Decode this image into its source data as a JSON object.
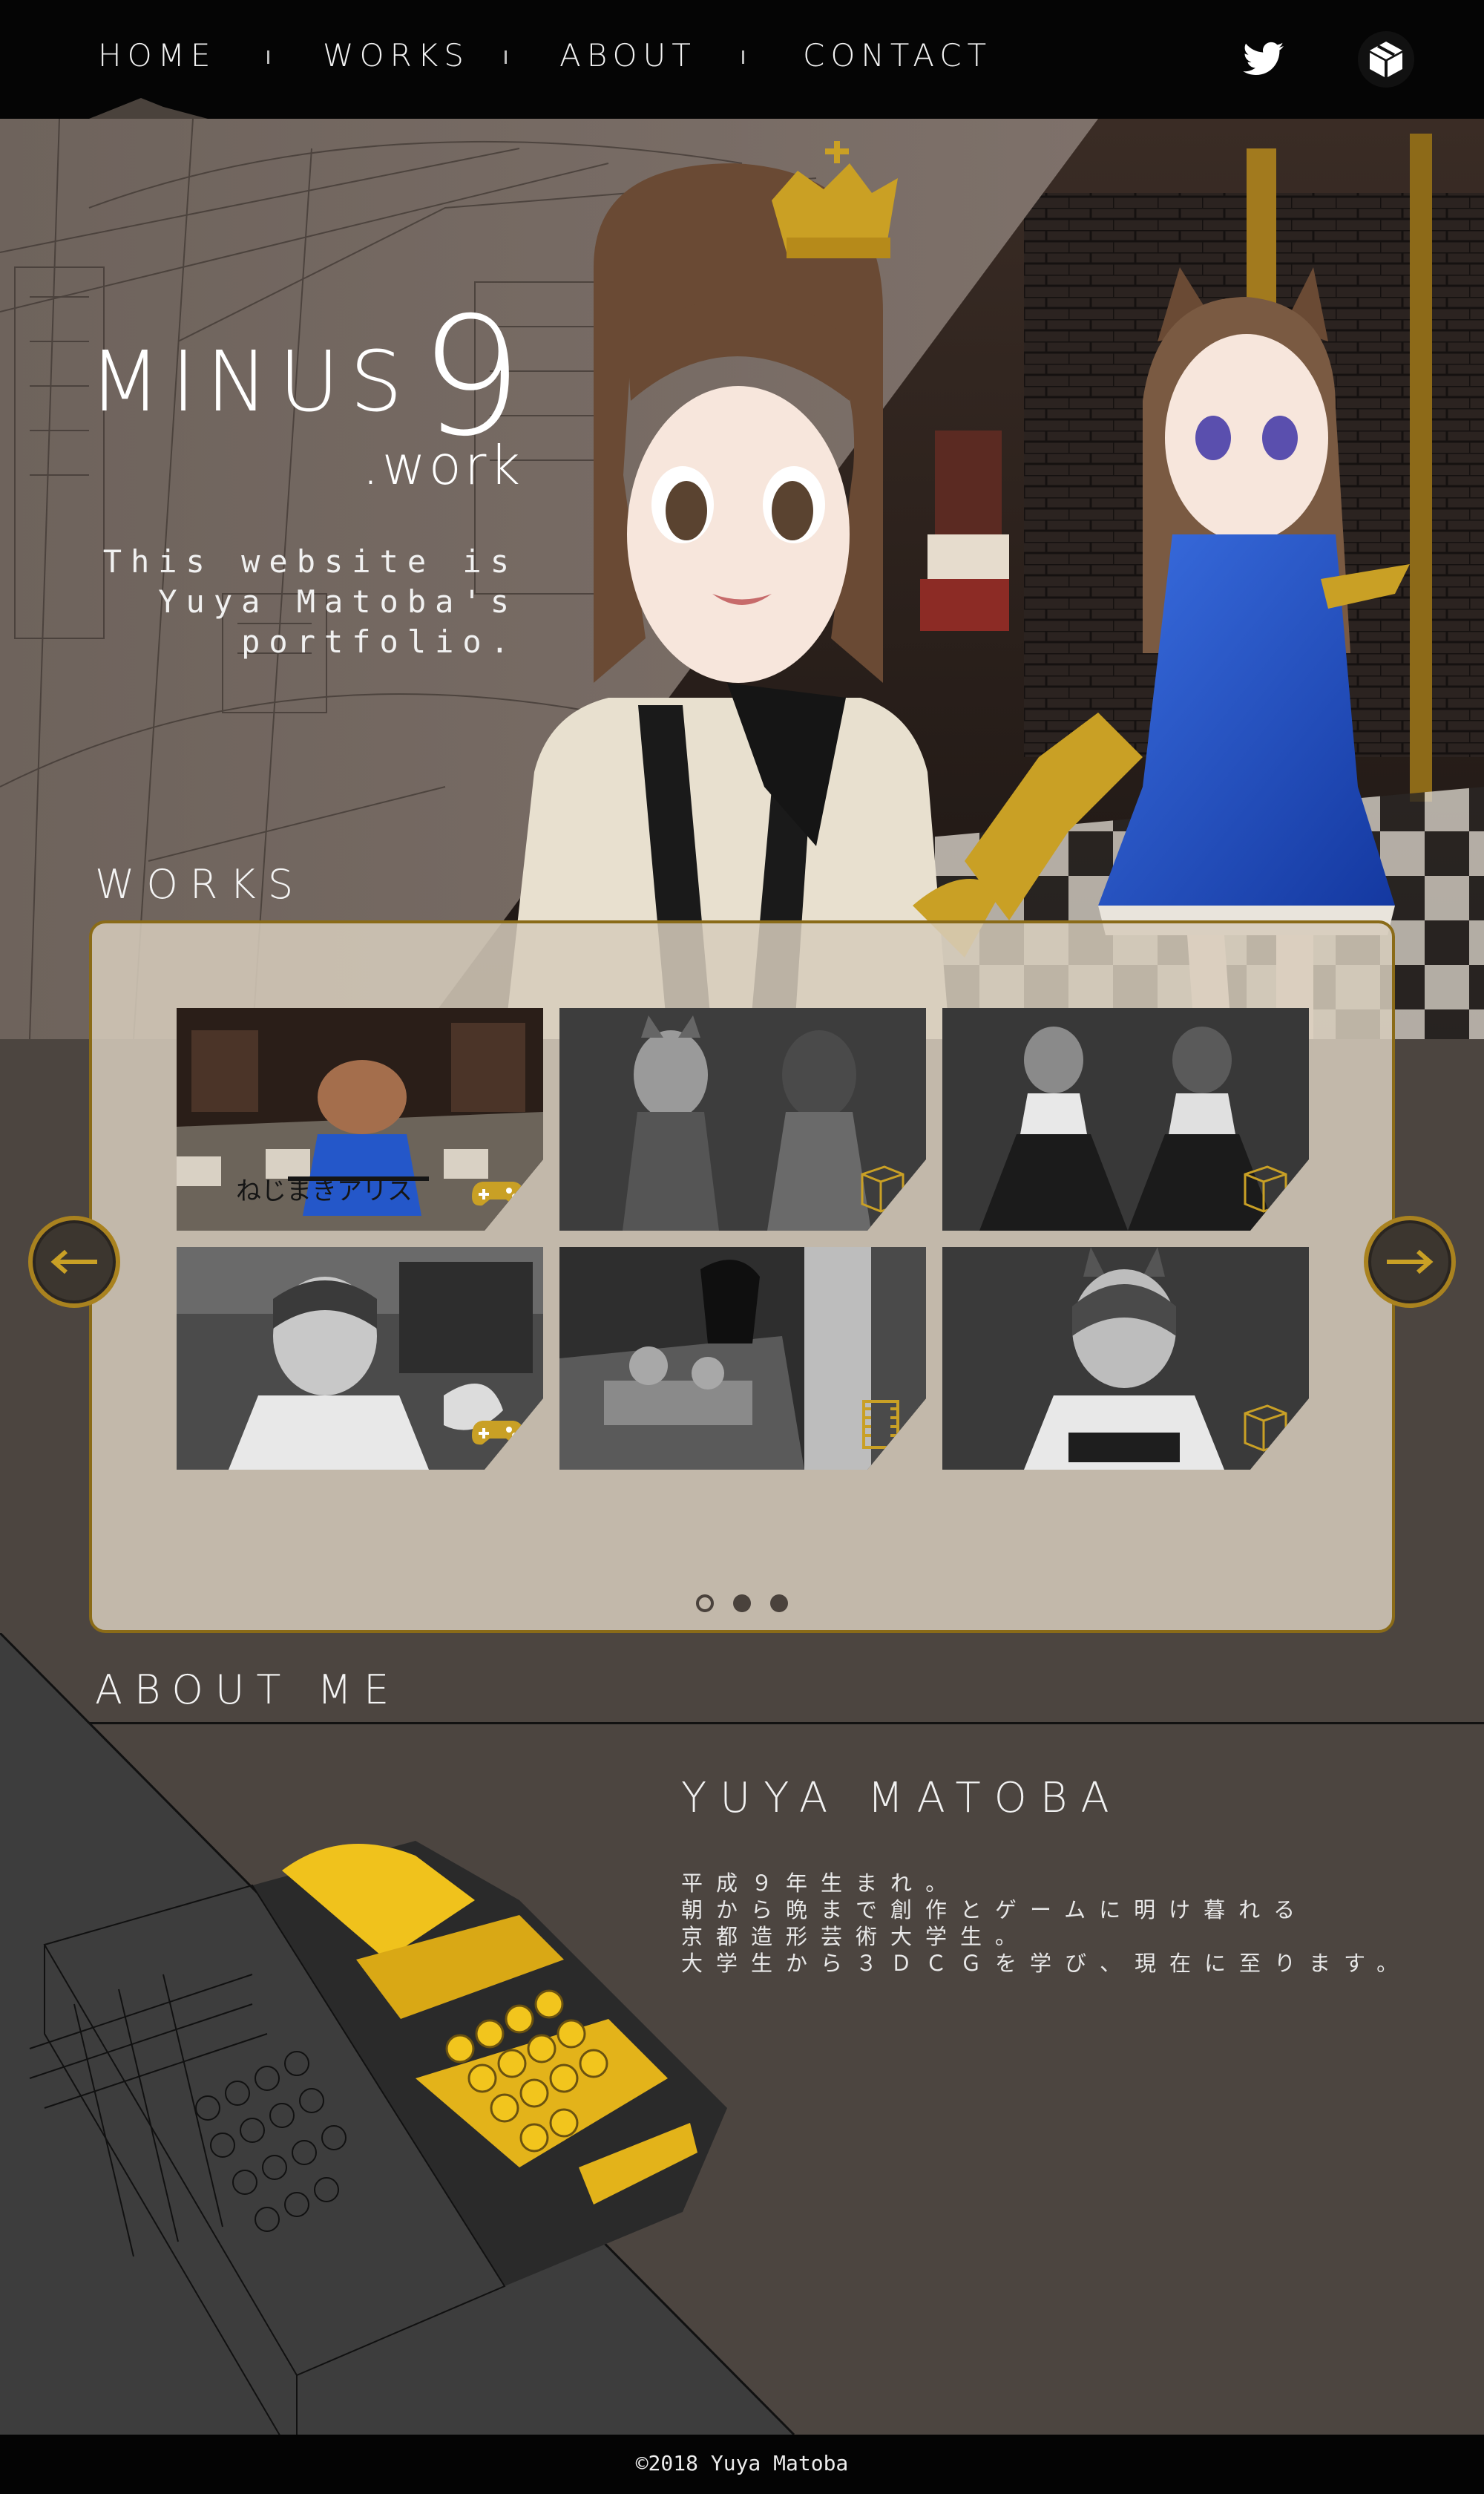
{
  "nav": {
    "items": [
      {
        "label": "HOME"
      },
      {
        "label": "WORKS"
      },
      {
        "label": "ABOUT"
      },
      {
        "label": "CONTACT"
      }
    ],
    "icons": [
      "twitter-icon",
      "cube-icon"
    ]
  },
  "hero": {
    "logo_minus": "MINUS",
    "logo_nine": "9",
    "logo_work": ".work",
    "tagline_lines": [
      "This website is",
      "Yuya Matoba's",
      "portfolio."
    ]
  },
  "works": {
    "title": "WORKS",
    "items": [
      {
        "kind": "game-icon",
        "caption": "ねじまきアリス"
      },
      {
        "kind": "model-icon"
      },
      {
        "kind": "model-icon"
      },
      {
        "kind": "game-icon"
      },
      {
        "kind": "film-icon"
      },
      {
        "kind": "model-icon"
      }
    ],
    "pagination": {
      "pages": 3,
      "current": 1
    },
    "prev_icon": "arrow-left-icon",
    "next_icon": "arrow-right-icon"
  },
  "about": {
    "title": "ABOUT ME",
    "name": "YUYA MATOBA",
    "lines": [
      "平成９年生まれ。",
      "朝から晩まで創作とゲームに明け暮れる",
      "京都造形芸術大学生。",
      "大学生から３ＤＣＧを学び、現在に至ります。"
    ]
  },
  "footer": {
    "copyright": "©2018  Yuya Matoba"
  },
  "colors": {
    "nav_bg": "#050505",
    "page_bg": "#4c4540",
    "accent_gold": "#b8901f",
    "panel_bg": "#d6ccbc",
    "dress_blue": "#1f4fc4"
  }
}
